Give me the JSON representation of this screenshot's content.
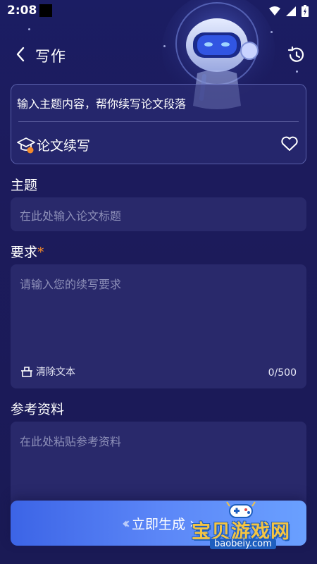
{
  "status_bar": {
    "time": "2:08"
  },
  "header": {
    "title": "写作"
  },
  "template": {
    "description": "输入主题内容，帮你续写论文段落",
    "name": "论文续写"
  },
  "topic": {
    "label": "主题",
    "placeholder": "在此处输入论文标题"
  },
  "requirements": {
    "label": "要求",
    "required_mark": "*",
    "placeholder": "请输入您的续写要求",
    "clear_label": "清除文本",
    "char_count": "0/500"
  },
  "reference": {
    "label": "参考资料",
    "placeholder": "在此处粘贴参考资料"
  },
  "generate": {
    "label": "立即生成",
    "arrows_left": "‹‹‹",
    "arrow_right": "›"
  },
  "watermark": {
    "text": "宝贝游戏网",
    "url": "baobeiy.com"
  },
  "colors": {
    "background": "#1c1c5a",
    "field": "#29296b",
    "accent_star": "#f48a2a",
    "button_start": "#3c64e6",
    "button_end": "#6aa0ff"
  },
  "icons": [
    "back-arrow-icon",
    "history-icon",
    "graduation-cap-icon",
    "heart-icon",
    "clear-icon",
    "wifi-icon",
    "signal-icon",
    "battery-icon"
  ]
}
